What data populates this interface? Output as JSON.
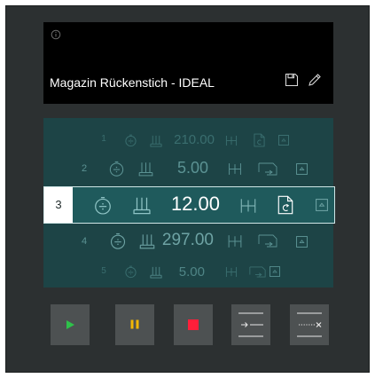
{
  "program": {
    "title": "Magazin Rückenstich - IDEAL"
  },
  "stations": [
    {
      "number": "1",
      "value": "210.00"
    },
    {
      "number": "2",
      "value": "5.00"
    },
    {
      "number": "3",
      "value": "12.00"
    },
    {
      "number": "4",
      "value": "297.00"
    },
    {
      "number": "5",
      "value": "5.00"
    }
  ],
  "selected_station": "3",
  "icons": {
    "header": [
      "info-icon",
      "save-icon",
      "edit-icon"
    ],
    "row": [
      "timer-icon",
      "stack-icon",
      "spacing-icon",
      "document-icon",
      "box-icon"
    ],
    "buttons": [
      "play-icon",
      "pause-icon",
      "stop-icon",
      "insert-line-icon",
      "delete-line-icon"
    ]
  },
  "colors": {
    "play": "#2ec24a",
    "pause": "#f2b705",
    "stop": "#ff1f3a",
    "list_background": "#1d4446",
    "selected_row": "#1f5a5c"
  }
}
